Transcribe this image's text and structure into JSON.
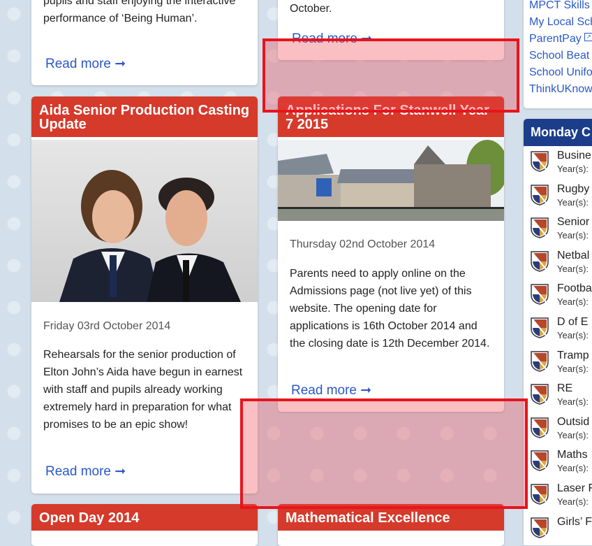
{
  "col1": {
    "top_card": {
      "text_tail": "pupils and staff enjoying the interactive performance of ‘Being Human’.",
      "read_more": "Read more ➞"
    },
    "aida_card": {
      "title": "Aida Senior Production Casting Update",
      "date": "Friday 03rd October 2014",
      "text": "Rehearsals for the senior production of Elton John’s Aida have begun in earnest with staff and pupils already working extremely hard in preparation for what promises to be an epic show!",
      "read_more": "Read more ➞"
    },
    "open_day_card": {
      "title": "Open Day 2014"
    }
  },
  "col2": {
    "top_card": {
      "text_tail": "October.",
      "read_more": "Read more ➞"
    },
    "applications_card": {
      "title": "Applications For Stanwell Year 7 2015",
      "date": "Thursday 02nd October 2014",
      "text": "Parents need to apply online on the Admissions page (not live yet) of this website. The opening date for applications is 16th October 2014 and the closing date is 12th December 2014.",
      "read_more": "Read more ➞"
    },
    "maths_card": {
      "title": "Mathematical Excellence"
    }
  },
  "sidebar": {
    "links": [
      {
        "label": "MPCT Skills A"
      },
      {
        "label": "My Local Sch"
      },
      {
        "label": "ParentPay",
        "icon": "external-link-icon"
      },
      {
        "label": "School Beat"
      },
      {
        "label": "School Unifo"
      },
      {
        "label": "ThinkUKnow"
      }
    ],
    "calendar": {
      "header": "Monday C",
      "items": [
        {
          "title": "Busine",
          "year": "Year(s): "
        },
        {
          "title": "Rugby",
          "year": "Year(s): "
        },
        {
          "title": "Senior",
          "year": "Year(s): "
        },
        {
          "title": "Netbal",
          "year": "Year(s): "
        },
        {
          "title": "Footba",
          "year": "Year(s): "
        },
        {
          "title": "D of E",
          "year": "Year(s): "
        },
        {
          "title": "Tramp",
          "year": "Year(s): "
        },
        {
          "title": "RE",
          "year": "Year(s): "
        },
        {
          "title": "Outsid",
          "year": "Year(s): "
        },
        {
          "title": "Maths",
          "year": "Year(s): "
        },
        {
          "title": "Laser F",
          "year": "Year(s): "
        },
        {
          "title": "Girls’ F",
          "year": ""
        }
      ]
    }
  },
  "colors": {
    "card_title_bg": "#d53a2b",
    "link": "#2a58c8",
    "calendar_header_bg": "#1c3d8a",
    "overlay_border": "#e8141c"
  }
}
